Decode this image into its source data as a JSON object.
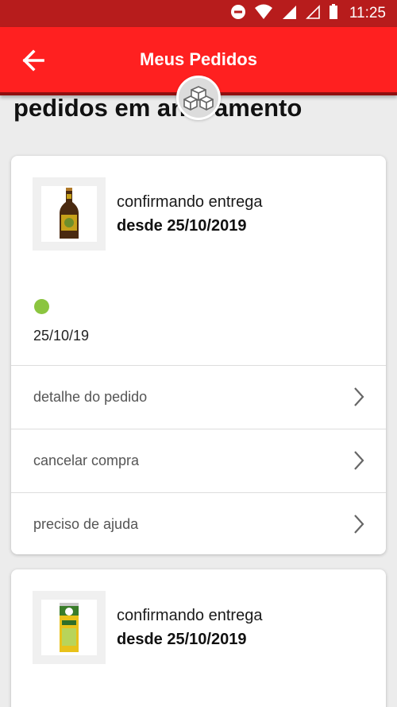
{
  "status_bar": {
    "time": "11:25",
    "icons": [
      "do-not-disturb-icon",
      "wifi-icon",
      "signal-icon",
      "signal-empty-icon",
      "battery-icon"
    ]
  },
  "app_bar": {
    "title": "Meus Pedidos",
    "back_icon": "arrow-left-icon",
    "background": "#ff2020"
  },
  "section": {
    "title": "pedidos em andamento",
    "title_visible_start": "pedidos em an",
    "title_visible_end": "amento"
  },
  "orders": [
    {
      "product_icon": "beer-bottle-icon",
      "status": "confirmando entrega",
      "since": "desde 25/10/2019",
      "step_color": "#8bc53f",
      "step_date": "25/10/19",
      "actions": [
        {
          "label": "detalhe do pedido"
        },
        {
          "label": "cancelar compra"
        },
        {
          "label": "preciso de ajuda"
        }
      ]
    },
    {
      "product_icon": "chips-can-icon",
      "status": "confirmando entrega",
      "since": "desde 25/10/2019"
    }
  ]
}
